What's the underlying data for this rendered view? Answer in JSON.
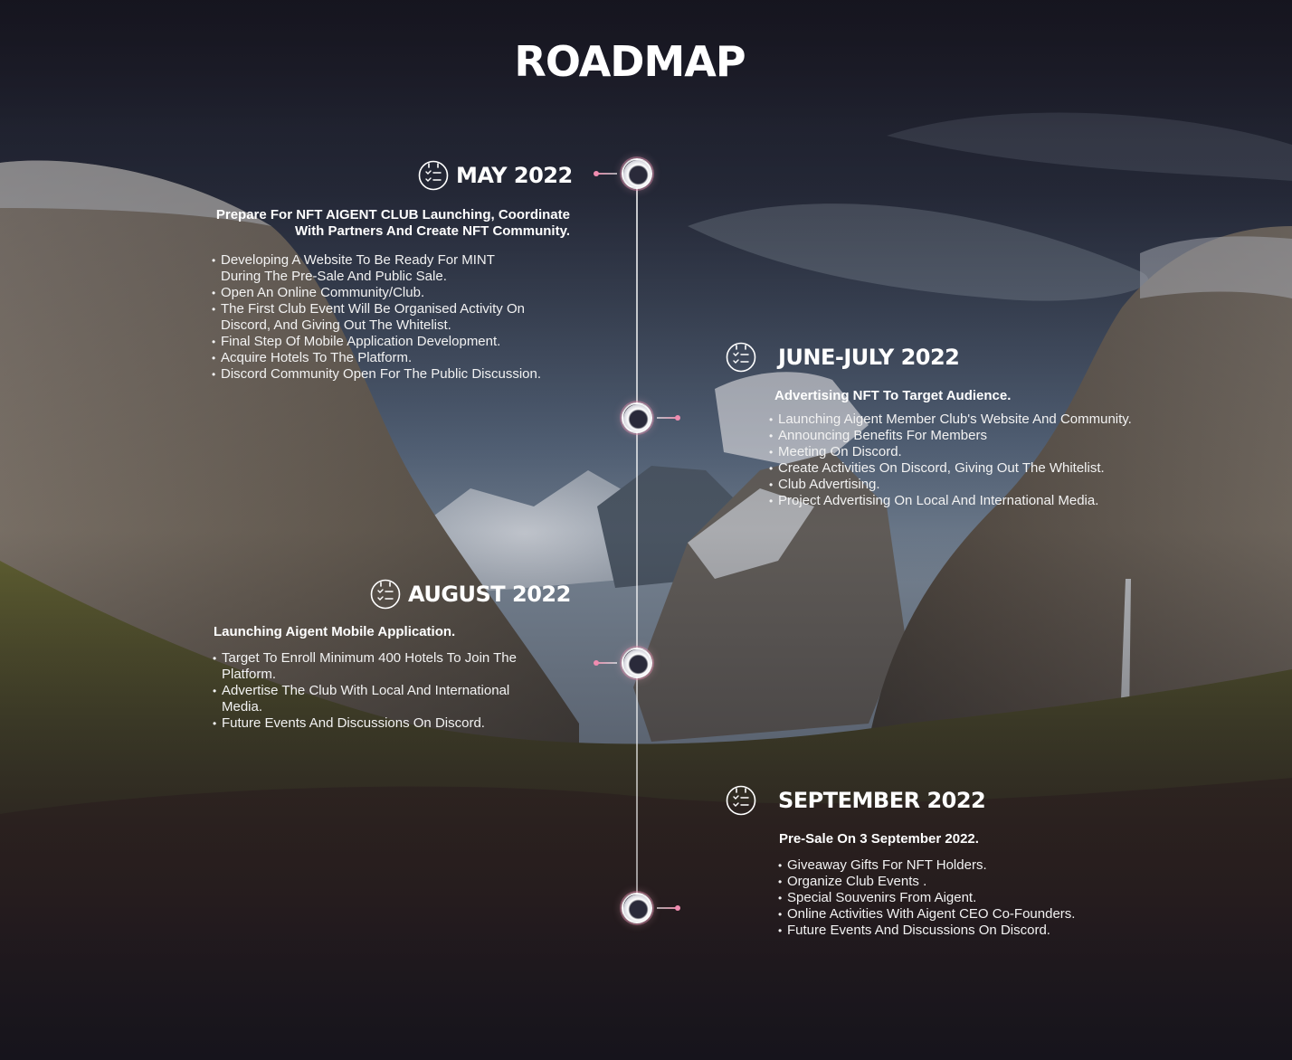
{
  "title": "ROADMAP",
  "colors": {
    "accent_pink": "#f08cb0",
    "text": "#ffffff",
    "overlay_dark": "#1b1a24"
  },
  "phases": [
    {
      "title": "MAY 2022",
      "icon": "checklist-icon",
      "subtitle_line1": "Prepare For NFT AIGENT CLUB Launching, Coordinate",
      "subtitle_line2": "With Partners And Create NFT Community.",
      "items": [
        "Developing A Website To Be Ready For MINT During The Pre-Sale And Public Sale.",
        "Open An Online Community/Club.",
        "The First Club Event Will Be Organised Activity On Discord, And Giving Out The Whitelist.",
        "Final Step Of Mobile Application Development.",
        "Acquire Hotels To The Platform.",
        "Discord Community Open For The Public Discussion."
      ]
    },
    {
      "title": "JUNE-JULY 2022",
      "icon": "checklist-icon",
      "subtitle": "Advertising NFT To Target Audience.",
      "items": [
        "Launching Aigent Member Club's Website  And Community.",
        "Announcing Benefits For Members",
        "Meeting On Discord.",
        "Create Activities On Discord, Giving Out The Whitelist.",
        "Club Advertising.",
        "Project Advertising On Local And International Media."
      ]
    },
    {
      "title": "AUGUST 2022",
      "icon": "checklist-icon",
      "subtitle": "Launching Aigent Mobile Application.",
      "items": [
        "Target To Enroll Minimum 400 Hotels To Join The Platform.",
        "Advertise The Club With Local And International Media.",
        "Future Events And Discussions On Discord."
      ]
    },
    {
      "title": "SEPTEMBER 2022",
      "icon": "checklist-icon",
      "subtitle": "Pre-Sale On 3 September 2022.",
      "items": [
        "Giveaway Gifts For NFT Holders.",
        "Organize Club Events .",
        "Special Souvenirs From Aigent.",
        "Online Activities With Aigent  CEO Co-Founders.",
        "Future Events And Discussions  On Discord."
      ]
    }
  ]
}
